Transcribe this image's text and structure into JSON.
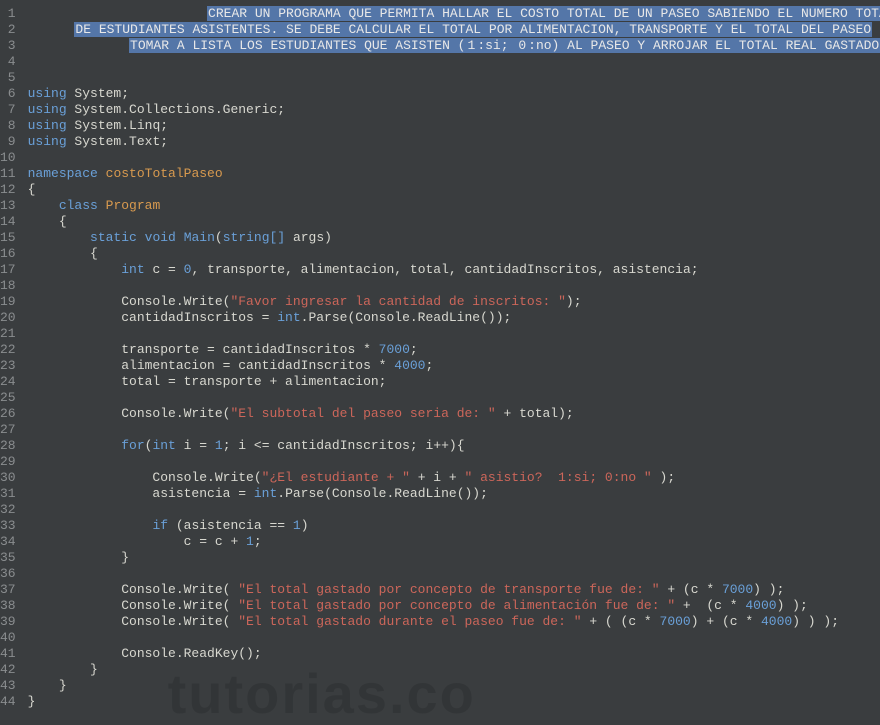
{
  "watermark": "tutorias.co",
  "lines": [
    {
      "n": 1,
      "tokens": [
        {
          "t": "                       "
        },
        {
          "t": "CREAR UN PROGRAMA QUE PERMITA HALLAR EL COSTO TOTAL DE UN PASEO SABIENDO EL NUMERO TOTAL",
          "c": "sel"
        }
      ]
    },
    {
      "n": 2,
      "tokens": [
        {
          "t": "      "
        },
        {
          "t": "DE ESTUDIANTES ASISTENTES. SE DEBE CALCULAR EL TOTAL POR ALIMENTACION, TRANSPORTE Y EL TOTAL DEL PASEO",
          "c": "sel"
        }
      ]
    },
    {
      "n": 3,
      "tokens": [
        {
          "t": "             "
        },
        {
          "t": "TOMAR A LISTA LOS ESTUDIANTES QUE ASISTEN (",
          "c": "sel"
        },
        {
          "t": "1",
          "c": "sel num"
        },
        {
          "t": ":si; ",
          "c": "sel"
        },
        {
          "t": "0",
          "c": "sel num"
        },
        {
          "t": ":no) AL PASEO Y ARROJAR EL TOTAL REAL GASTADO",
          "c": "sel"
        }
      ]
    },
    {
      "n": 4,
      "tokens": [
        {
          "t": ""
        }
      ]
    },
    {
      "n": 5,
      "tokens": [
        {
          "t": ""
        }
      ]
    },
    {
      "n": 6,
      "tokens": [
        {
          "t": "using",
          "c": "kw"
        },
        {
          "t": " System;"
        }
      ]
    },
    {
      "n": 7,
      "tokens": [
        {
          "t": "using",
          "c": "kw"
        },
        {
          "t": " System.Collections.Generic;"
        }
      ]
    },
    {
      "n": 8,
      "tokens": [
        {
          "t": "using",
          "c": "kw"
        },
        {
          "t": " System.Linq;"
        }
      ]
    },
    {
      "n": 9,
      "tokens": [
        {
          "t": "using",
          "c": "kw"
        },
        {
          "t": " System.Text;"
        }
      ]
    },
    {
      "n": 10,
      "tokens": [
        {
          "t": ""
        }
      ]
    },
    {
      "n": 11,
      "tokens": [
        {
          "t": "namespace",
          "c": "kw"
        },
        {
          "t": " "
        },
        {
          "t": "costoTotalPaseo",
          "c": "name"
        }
      ]
    },
    {
      "n": 12,
      "tokens": [
        {
          "t": "{"
        }
      ]
    },
    {
      "n": 13,
      "tokens": [
        {
          "t": "    "
        },
        {
          "t": "class",
          "c": "kw"
        },
        {
          "t": " "
        },
        {
          "t": "Program",
          "c": "name"
        }
      ]
    },
    {
      "n": 14,
      "tokens": [
        {
          "t": "    {"
        }
      ]
    },
    {
      "n": 15,
      "tokens": [
        {
          "t": "        "
        },
        {
          "t": "static",
          "c": "kw"
        },
        {
          "t": " "
        },
        {
          "t": "void",
          "c": "kw"
        },
        {
          "t": " "
        },
        {
          "t": "Main",
          "c": "meth"
        },
        {
          "t": "("
        },
        {
          "t": "string",
          "c": "kw"
        },
        {
          "t": "[]",
          "c": "kw"
        },
        {
          "t": " args)"
        }
      ]
    },
    {
      "n": 16,
      "tokens": [
        {
          "t": "        {"
        }
      ]
    },
    {
      "n": 17,
      "tokens": [
        {
          "t": "            "
        },
        {
          "t": "int",
          "c": "kw"
        },
        {
          "t": " c = "
        },
        {
          "t": "0",
          "c": "num"
        },
        {
          "t": ", transporte, alimentacion, total, cantidadInscritos, asistencia;"
        }
      ]
    },
    {
      "n": 18,
      "tokens": [
        {
          "t": ""
        }
      ]
    },
    {
      "n": 19,
      "tokens": [
        {
          "t": "            Console.Write("
        },
        {
          "t": "\"Favor ingresar la cantidad de inscritos: \"",
          "c": "str"
        },
        {
          "t": ");"
        }
      ]
    },
    {
      "n": 20,
      "tokens": [
        {
          "t": "            cantidadInscritos = "
        },
        {
          "t": "int",
          "c": "kw"
        },
        {
          "t": ".Parse(Console.ReadLine());"
        }
      ]
    },
    {
      "n": 21,
      "tokens": [
        {
          "t": ""
        }
      ]
    },
    {
      "n": 22,
      "tokens": [
        {
          "t": "            transporte = cantidadInscritos * "
        },
        {
          "t": "7000",
          "c": "num"
        },
        {
          "t": ";"
        }
      ]
    },
    {
      "n": 23,
      "tokens": [
        {
          "t": "            alimentacion = cantidadInscritos * "
        },
        {
          "t": "4000",
          "c": "num"
        },
        {
          "t": ";"
        }
      ]
    },
    {
      "n": 24,
      "tokens": [
        {
          "t": "            total = transporte + alimentacion;"
        }
      ]
    },
    {
      "n": 25,
      "tokens": [
        {
          "t": ""
        }
      ]
    },
    {
      "n": 26,
      "tokens": [
        {
          "t": "            Console.Write("
        },
        {
          "t": "\"El subtotal del paseo seria de: \"",
          "c": "str"
        },
        {
          "t": " + total);"
        }
      ]
    },
    {
      "n": 27,
      "tokens": [
        {
          "t": ""
        }
      ]
    },
    {
      "n": 28,
      "tokens": [
        {
          "t": "            "
        },
        {
          "t": "for",
          "c": "kw"
        },
        {
          "t": "("
        },
        {
          "t": "int",
          "c": "kw"
        },
        {
          "t": " i = "
        },
        {
          "t": "1",
          "c": "num"
        },
        {
          "t": "; i <= cantidadInscritos; i++){"
        }
      ]
    },
    {
      "n": 29,
      "tokens": [
        {
          "t": ""
        }
      ]
    },
    {
      "n": 30,
      "tokens": [
        {
          "t": "                Console.Write("
        },
        {
          "t": "\"¿El estudiante + \"",
          "c": "str"
        },
        {
          "t": " + i + "
        },
        {
          "t": "\" asistio?  1:si; 0:no \"",
          "c": "str"
        },
        {
          "t": " );"
        }
      ]
    },
    {
      "n": 31,
      "tokens": [
        {
          "t": "                asistencia = "
        },
        {
          "t": "int",
          "c": "kw"
        },
        {
          "t": ".Parse(Console.ReadLine());"
        }
      ]
    },
    {
      "n": 32,
      "tokens": [
        {
          "t": ""
        }
      ]
    },
    {
      "n": 33,
      "tokens": [
        {
          "t": "                "
        },
        {
          "t": "if",
          "c": "kw"
        },
        {
          "t": " (asistencia == "
        },
        {
          "t": "1",
          "c": "num"
        },
        {
          "t": ")"
        }
      ]
    },
    {
      "n": 34,
      "tokens": [
        {
          "t": "                    c = c + "
        },
        {
          "t": "1",
          "c": "num"
        },
        {
          "t": ";"
        }
      ]
    },
    {
      "n": 35,
      "tokens": [
        {
          "t": "            }"
        }
      ]
    },
    {
      "n": 36,
      "tokens": [
        {
          "t": ""
        }
      ]
    },
    {
      "n": 37,
      "tokens": [
        {
          "t": "            Console.Write( "
        },
        {
          "t": "\"El total gastado por concepto de transporte fue de: \"",
          "c": "str"
        },
        {
          "t": " + (c * "
        },
        {
          "t": "7000",
          "c": "num"
        },
        {
          "t": ") );"
        }
      ]
    },
    {
      "n": 38,
      "tokens": [
        {
          "t": "            Console.Write( "
        },
        {
          "t": "\"El total gastado por concepto de alimentación fue de: \"",
          "c": "str"
        },
        {
          "t": " +  (c * "
        },
        {
          "t": "4000",
          "c": "num"
        },
        {
          "t": ") );"
        }
      ]
    },
    {
      "n": 39,
      "tokens": [
        {
          "t": "            Console.Write( "
        },
        {
          "t": "\"El total gastado durante el paseo fue de: \"",
          "c": "str"
        },
        {
          "t": " + ( (c * "
        },
        {
          "t": "7000",
          "c": "num"
        },
        {
          "t": ") + (c * "
        },
        {
          "t": "4000",
          "c": "num"
        },
        {
          "t": ") ) );"
        }
      ]
    },
    {
      "n": 40,
      "tokens": [
        {
          "t": ""
        }
      ]
    },
    {
      "n": 41,
      "tokens": [
        {
          "t": "            Console.ReadKey();"
        }
      ]
    },
    {
      "n": 42,
      "tokens": [
        {
          "t": "        }"
        }
      ]
    },
    {
      "n": 43,
      "tokens": [
        {
          "t": "    }"
        }
      ]
    },
    {
      "n": 44,
      "tokens": [
        {
          "t": "}"
        }
      ]
    }
  ]
}
